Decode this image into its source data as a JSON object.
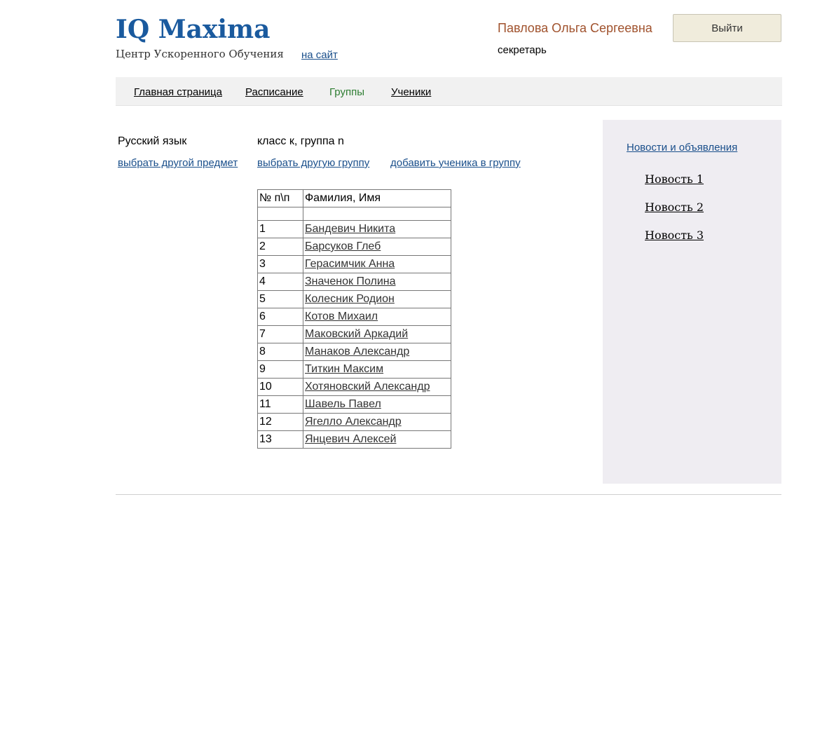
{
  "header": {
    "logo": "IQ Maxima",
    "tagline": "Центр Ускоренного Обучения",
    "site_link": "на сайт",
    "user_name": "Павлова Ольга Сергеевна",
    "user_role": "секретарь",
    "logout_label": "Выйти"
  },
  "nav": {
    "items": [
      {
        "label": "Главная страница"
      },
      {
        "label": "Расписание"
      },
      {
        "label": "Группы",
        "active": true
      },
      {
        "label": "Ученики"
      }
    ]
  },
  "main": {
    "subject": "Русский язык",
    "group": "класс к, группа n",
    "links": {
      "change_subject": "выбрать другой предмет",
      "change_group": "выбрать другую группу",
      "add_student": "добавить ученика в группу"
    },
    "table": {
      "headers": [
        "№ п\\п",
        "Фамилия, Имя"
      ],
      "rows": [
        {
          "num": "1",
          "name": "Бандевич Никита"
        },
        {
          "num": "2",
          "name": "Барсуков Глеб"
        },
        {
          "num": "3",
          "name": "Герасимчик Анна"
        },
        {
          "num": "4",
          "name": "Значенок Полина"
        },
        {
          "num": "5",
          "name": "Колесник Родион"
        },
        {
          "num": "6",
          "name": "Котов Михаил"
        },
        {
          "num": "7",
          "name": "Маковский Аркадий"
        },
        {
          "num": "8",
          "name": "Манаков Александр"
        },
        {
          "num": "9",
          "name": "Титкин Максим"
        },
        {
          "num": "10",
          "name": "Хотяновский Александр"
        },
        {
          "num": "11",
          "name": "Шавель Павел"
        },
        {
          "num": "12",
          "name": "Ягелло Александр"
        },
        {
          "num": "13",
          "name": "Янцевич Алексей"
        }
      ]
    }
  },
  "sidebar": {
    "heading": "Новости и объявления",
    "news": [
      "Новость 1",
      "Новость 2",
      "Новость 3"
    ]
  },
  "colors": {
    "brand": "#1a5a9e",
    "link": "#1a4f8b",
    "user_name": "#a0522d",
    "active_nav": "#2e7d32",
    "sidebar_bg": "#efedf2",
    "nav_bg": "#f1f1f1",
    "logout_bg": "#f0ecdc"
  }
}
